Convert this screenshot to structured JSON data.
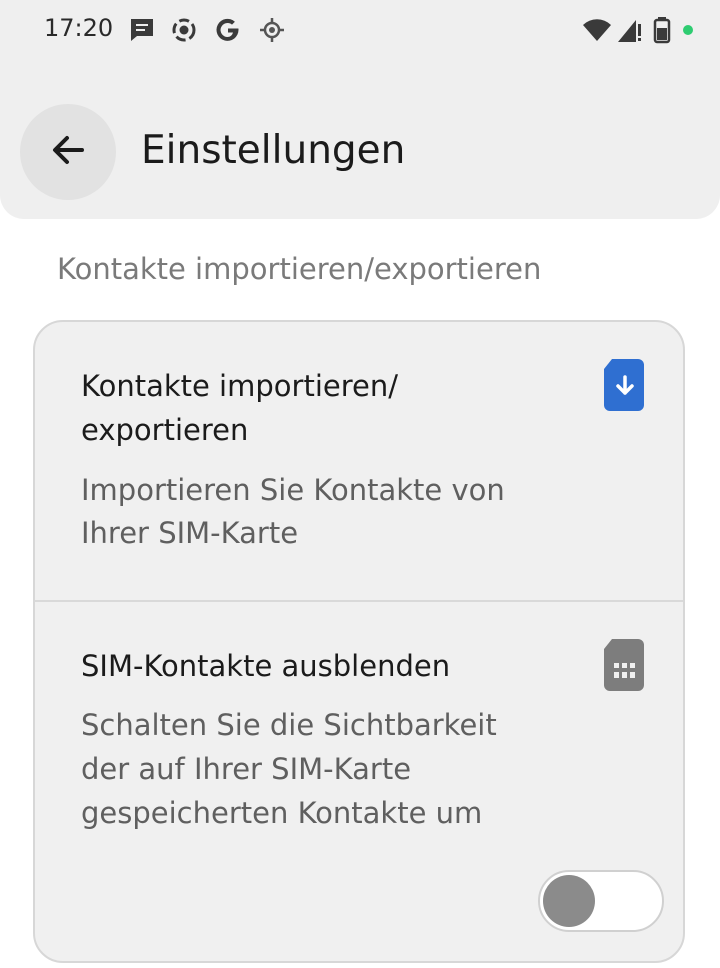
{
  "status_bar": {
    "time": "17:20",
    "left_icons": [
      "message-icon",
      "screen-record-icon",
      "google-icon",
      "location-icon"
    ],
    "right_icons": [
      "wifi-icon",
      "signal-icon",
      "battery-icon",
      "dot-indicator"
    ],
    "dot_color": "#2ecc71"
  },
  "header": {
    "back_icon": "arrow-left-icon",
    "title": "Einstellungen"
  },
  "section": {
    "title": "Kontakte importieren/exportieren"
  },
  "items": [
    {
      "title_line1": "Kontakte importieren/",
      "title_line2": "exportieren",
      "sub_line1": "Importieren Sie Kontakte von",
      "sub_line2": "Ihrer SIM-Karte",
      "icon": "sim-import-icon",
      "icon_color": "#2f6fd1"
    },
    {
      "title": "SIM-Kontakte ausblenden",
      "sub_line1": "Schalten Sie die Sichtbarkeit",
      "sub_line2": "der auf Ihrer SIM-Karte",
      "sub_line3": "gespeicherten Kontakte um",
      "icon": "sim-card-icon",
      "icon_color": "#7d7d7d",
      "toggle_on": false
    }
  ]
}
